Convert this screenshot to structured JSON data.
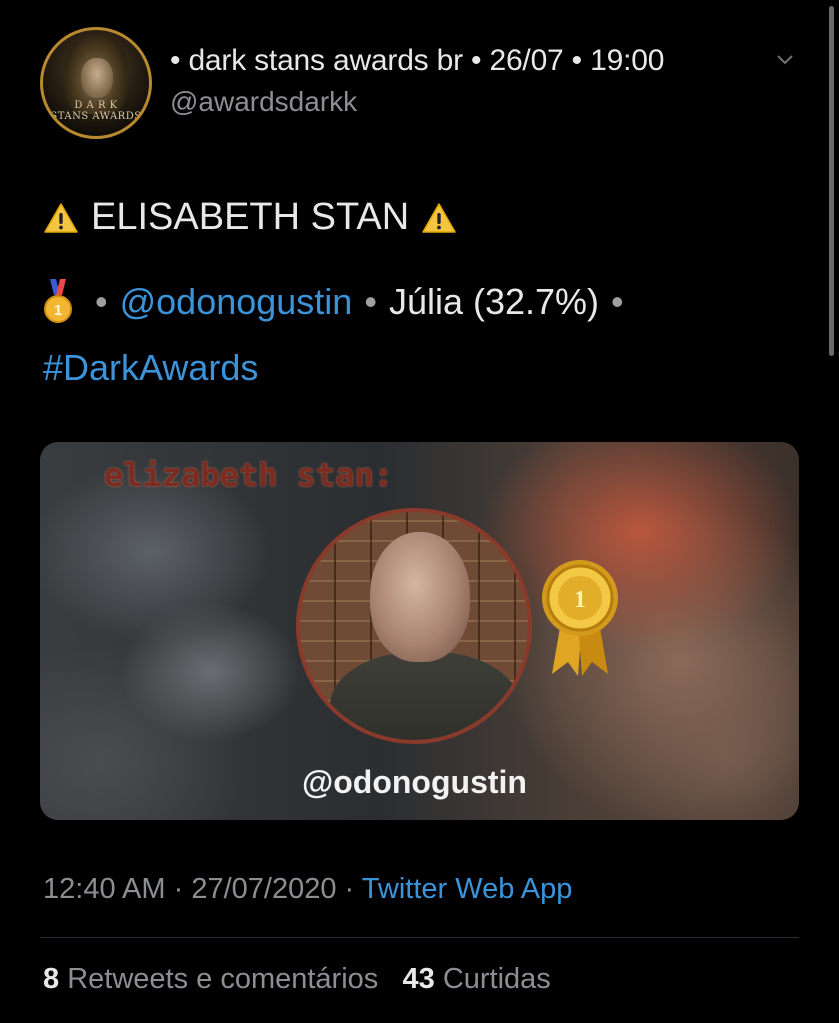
{
  "tweet": {
    "author_line": "• dark stans awards br • 26/07 • 19:00",
    "handle": "@awardsdarkk",
    "avatar_text_1": "D A R K",
    "avatar_text_2": "STANS AWARDS",
    "title": "ELISABETH STAN",
    "bullet": "•",
    "mention": "@odonogustin",
    "result": "Júlia (32.7%)",
    "hashtag": "#DarkAwards"
  },
  "media": {
    "title": "elizabeth stan:",
    "handle": "@odonogustin"
  },
  "meta": {
    "time": "12:40 AM",
    "dot": "·",
    "date": "27/07/2020",
    "app": "Twitter Web App"
  },
  "stats": {
    "retweets_count": "8",
    "retweets_label": "Retweets e comentários",
    "likes_count": "43",
    "likes_label": "Curtidas"
  },
  "icons": {
    "warning": "warning-icon",
    "medal": "first-place-medal-icon",
    "chevron": "chevron-down-icon",
    "ribbon": "award-ribbon-icon"
  },
  "colors": {
    "background": "#000000",
    "link": "#3b94d9",
    "secondary_text": "#8b8f94",
    "avatar_ring": "#b8892f"
  }
}
